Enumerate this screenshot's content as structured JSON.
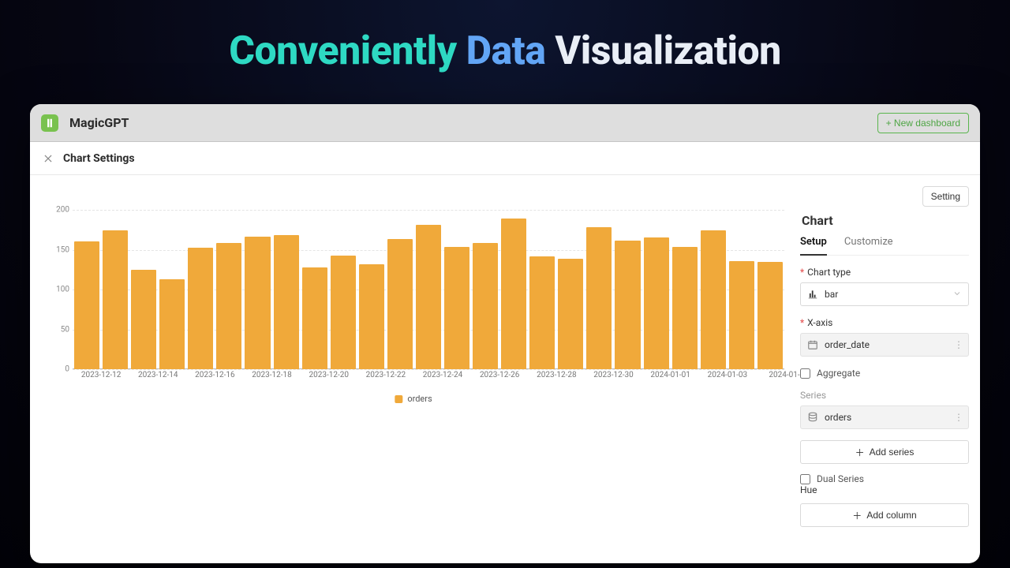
{
  "hero": {
    "w1": "Conveniently",
    "w2": "Data",
    "w3": "Visualization"
  },
  "app": {
    "name": "MagicGPT",
    "new_dashboard_btn": "+ New dashboard",
    "subheader_title": "Chart Settings",
    "setting_btn": "Setting"
  },
  "panel": {
    "title": "Chart",
    "tabs": {
      "setup": "Setup",
      "customize": "Customize"
    },
    "labels": {
      "chart_type": "Chart type",
      "x_axis": "X-axis",
      "aggregate": "Aggregate",
      "series": "Series",
      "add_series": "Add series",
      "dual_series": "Dual Series",
      "hue": "Hue",
      "add_column": "Add column"
    },
    "values": {
      "chart_type": "bar",
      "x_axis_field": "order_date",
      "series_field": "orders"
    }
  },
  "chart_data": {
    "type": "bar",
    "title": "",
    "xlabel": "",
    "ylabel": "",
    "ylim": [
      0,
      200
    ],
    "yticks": [
      0,
      50,
      100,
      150,
      200
    ],
    "x_tick_labels": [
      "2023-12-12",
      "2023-12-14",
      "2023-12-16",
      "2023-12-18",
      "2023-12-20",
      "2023-12-22",
      "2023-12-24",
      "2023-12-26",
      "2023-12-28",
      "2023-12-30",
      "2024-01-01",
      "2024-01-03",
      "2024-01-"
    ],
    "x_tick_interval": 2,
    "series": [
      {
        "name": "orders",
        "color": "#f0a93a",
        "values": [
          160,
          174,
          125,
          113,
          152,
          158,
          166,
          168,
          128,
          143,
          132,
          163,
          181,
          153,
          158,
          189,
          142,
          139,
          178,
          161,
          165,
          153,
          174,
          136,
          135
        ]
      }
    ]
  }
}
